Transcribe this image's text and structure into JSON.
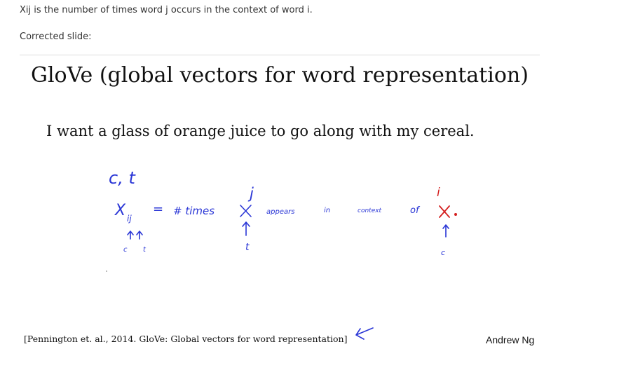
{
  "notes": {
    "definition": "Xij is the number of times word j occurs in the context of word i.",
    "corrected_label": "Corrected slide:"
  },
  "slide": {
    "title": "GloVe (global vectors for word representation)",
    "sentence": "I want a glass of orange juice to go along with my cereal.",
    "handwriting": {
      "ct_label": "c, t",
      "x_label": "X",
      "x_sub": "ij",
      "equals": "=",
      "hash_times": "# times",
      "j": "j",
      "appears": "appears",
      "in": "in",
      "context": "context",
      "of": "of",
      "i": "i",
      "c": "c",
      "t": "t",
      "ink_color": "#2a36d6",
      "correction_color": "#d41e1e"
    },
    "citation": "[Pennington et. al., 2014. GloVe: Global vectors for word representation]",
    "author": "Andrew Ng"
  }
}
